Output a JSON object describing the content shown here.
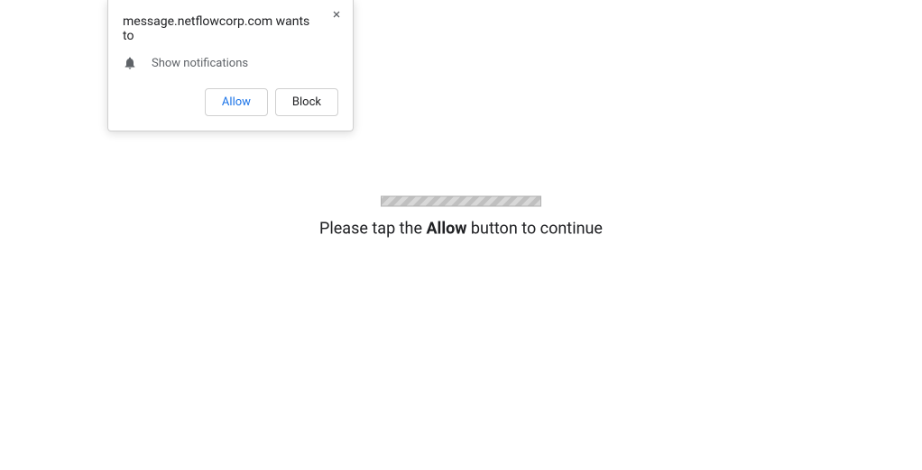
{
  "popup": {
    "title": "message.netflowcorp.com wants to",
    "notification_label": "Show notifications",
    "allow_label": "Allow",
    "block_label": "Block"
  },
  "main": {
    "instruction_prefix": "Please tap the ",
    "instruction_bold": "Allow",
    "instruction_suffix": " button to continue"
  }
}
